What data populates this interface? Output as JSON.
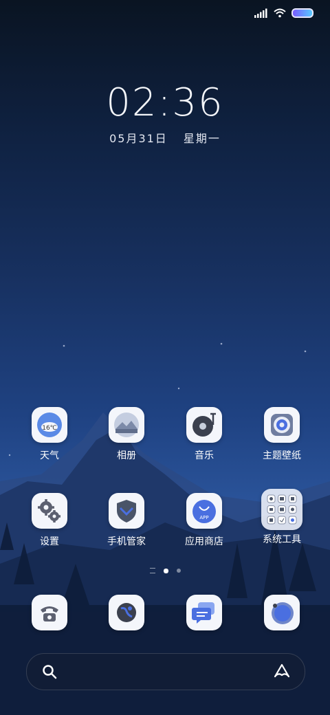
{
  "lockclock": {
    "time": "02:36",
    "date": "05月31日",
    "weekday": "星期一"
  },
  "status": {
    "signal_icon": "signal-icon",
    "wifi_icon": "wifi-icon",
    "battery_icon": "battery-icon"
  },
  "apps": [
    {
      "label": "天气",
      "icon": "weather-icon",
      "temp": "16℃"
    },
    {
      "label": "相册",
      "icon": "gallery-icon"
    },
    {
      "label": "音乐",
      "icon": "music-icon"
    },
    {
      "label": "主题壁纸",
      "icon": "themes-icon"
    },
    {
      "label": "设置",
      "icon": "settings-icon"
    },
    {
      "label": "手机管家",
      "icon": "security-icon"
    },
    {
      "label": "应用商店",
      "icon": "app-store-icon",
      "badge": "APP"
    },
    {
      "label": "系统工具",
      "icon": "tools-folder-icon"
    }
  ],
  "dock": [
    {
      "icon": "phone-icon"
    },
    {
      "icon": "browser-icon"
    },
    {
      "icon": "messages-icon"
    },
    {
      "icon": "camera-icon"
    }
  ],
  "search": {
    "search_icon": "search-icon",
    "assistant_icon": "assistant-icon"
  },
  "colors": {
    "accent": "#4a6fe0",
    "icon_bg": "#f4f6fb"
  }
}
